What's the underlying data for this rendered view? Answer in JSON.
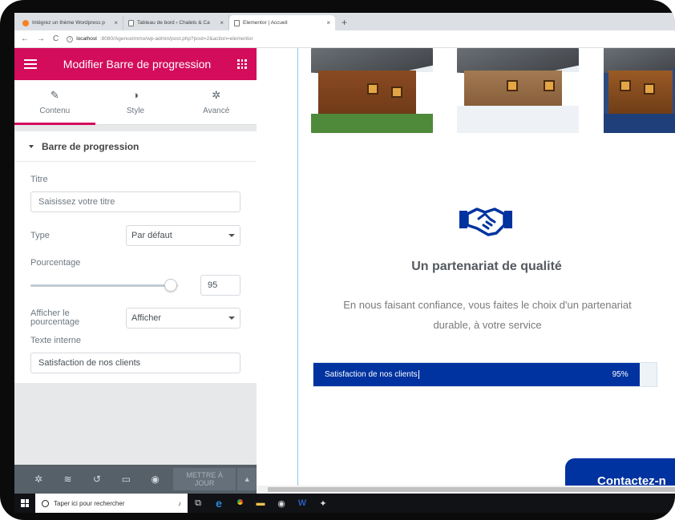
{
  "browser": {
    "tabs": [
      {
        "label": "Intégrez un thème Wordpress p",
        "close": "×"
      },
      {
        "label": "Tableau de bord ‹ Chalets & Ca",
        "close": "×"
      },
      {
        "label": "Elementor | Accueil",
        "close": "×"
      }
    ],
    "new_tab": "+",
    "url_host": "localhost",
    "url_rest": ":8080/AgenceImmo/wp-admin/post.php?post=2&action=elementor"
  },
  "panel": {
    "title": "Modifier Barre de progression",
    "tabs": [
      {
        "label": "Contenu",
        "icon": "pencil-icon"
      },
      {
        "label": "Style",
        "icon": "contrast-icon"
      },
      {
        "label": "Avancé",
        "icon": "gear-icon"
      }
    ],
    "section_title": "Barre de progression",
    "controls": {
      "titre_label": "Titre",
      "titre_placeholder": "Saisissez votre titre",
      "type_label": "Type",
      "type_value": "Par défaut",
      "pourcentage_label": "Pourcentage",
      "pourcentage_value": "95",
      "pourcentage_fraction": 0.95,
      "afficher_label_1": "Afficher le",
      "afficher_label_2": "pourcentage",
      "afficher_value": "Afficher",
      "texte_label": "Texte interne",
      "texte_value": "Satisfaction de nos clients"
    },
    "footer": {
      "update_line1": "METTRE À",
      "update_line2": "JOUR",
      "icons": [
        "settings-icon",
        "layers-icon",
        "history-icon",
        "responsive-icon",
        "preview-eye-icon"
      ]
    }
  },
  "preview": {
    "feature_title": "Un partenariat de qualité",
    "feature_text_1": "En nous faisant confiance, vous faites le choix d'un partenariat",
    "feature_text_2": "durable, à votre service",
    "progress_text": "Satisfaction de nos clients",
    "progress_percent_label": "95%",
    "progress_fraction": 0.95,
    "contact_label": "Contactez-n",
    "accent_color": "#0033a0",
    "brand_color": "#d30c5c"
  },
  "taskbar": {
    "search_placeholder": "Taper ici pour rechercher"
  }
}
